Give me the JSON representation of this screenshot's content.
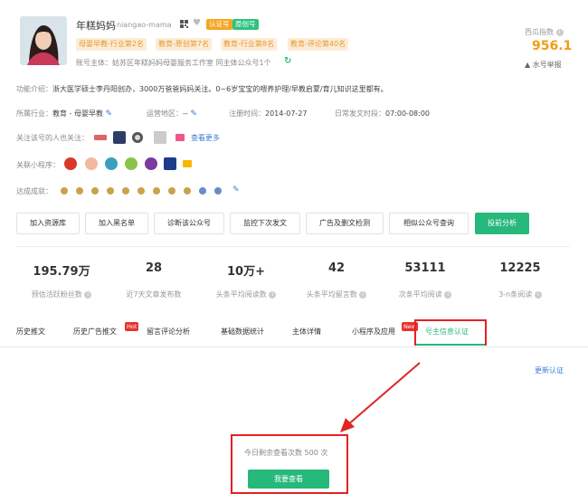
{
  "account": {
    "name": "年糕妈妈",
    "wechat_id": "niangao-mama",
    "badges": [
      {
        "label": "认证号",
        "color": "#f5a623"
      },
      {
        "label": "原创号",
        "color": "#2ec27e"
      }
    ],
    "tags": [
      "母婴早教-行业第2名",
      "教育-原创第7名",
      "教育-行业第8名",
      "教育-评论第40名"
    ],
    "subject_line": "账号主体：姑苏区年糕妈妈母婴服务工作室 同主体公众号1个"
  },
  "index": {
    "label": "西瓜指数",
    "value": "956.1",
    "report_label": "水号举报"
  },
  "details": {
    "intro_label": "功能介绍：",
    "intro_text": "浙大医学硕士李丹阳创办，3000万爸爸妈妈关注。0~6岁宝宝的喂养护理/早教启蒙/育儿知识这里都有。",
    "industry_label": "所属行业：",
    "industry_value": "教育 - 母婴早教",
    "region_label": "运营地区：",
    "region_value": "--",
    "register_label": "注册时间：",
    "register_value": "2014-07-27",
    "post_time_label": "日常发文时段：",
    "post_time_value": "07:00-08:00",
    "follow_label": "关注该号的人也关注：",
    "see_more": "查看更多",
    "mini_label": "关联小程序：",
    "achievement_label": "达成成就："
  },
  "actions": [
    "加入资源库",
    "加入黑名单",
    "诊断该公众号",
    "监控下次发文",
    "广告及删文检测",
    "相似公众号查询",
    "投前分析"
  ],
  "stats": [
    {
      "value": "195.79万",
      "label": "预估活跃粉丝数"
    },
    {
      "value": "28",
      "label": "近7天文章发布数"
    },
    {
      "value": "10万+",
      "label": "头条平均阅读数"
    },
    {
      "value": "42",
      "label": "头条平均留言数"
    },
    {
      "value": "53111",
      "label": "次条平均阅读"
    },
    {
      "value": "12225",
      "label": "3-n条阅读"
    }
  ],
  "tabs": {
    "history": "历史推文",
    "ad_history": "历史广告推文",
    "hot": "Hot",
    "comments": "留言评论分析",
    "basic_stats": "基础数据统计",
    "subject": "主体详情",
    "mini_apps": "小程序及应用",
    "new": "New",
    "owner_auth": "号主信息认证"
  },
  "content": {
    "refresh_auth": "更新认证",
    "quota_text": "今日剩余查看次数 500 次",
    "view_button": "我要查看"
  },
  "colors": {
    "accent_green": "#27b87c",
    "highlight_red": "#e32222",
    "index_orange": "#f39c12",
    "link_blue": "#3a7bd5"
  }
}
